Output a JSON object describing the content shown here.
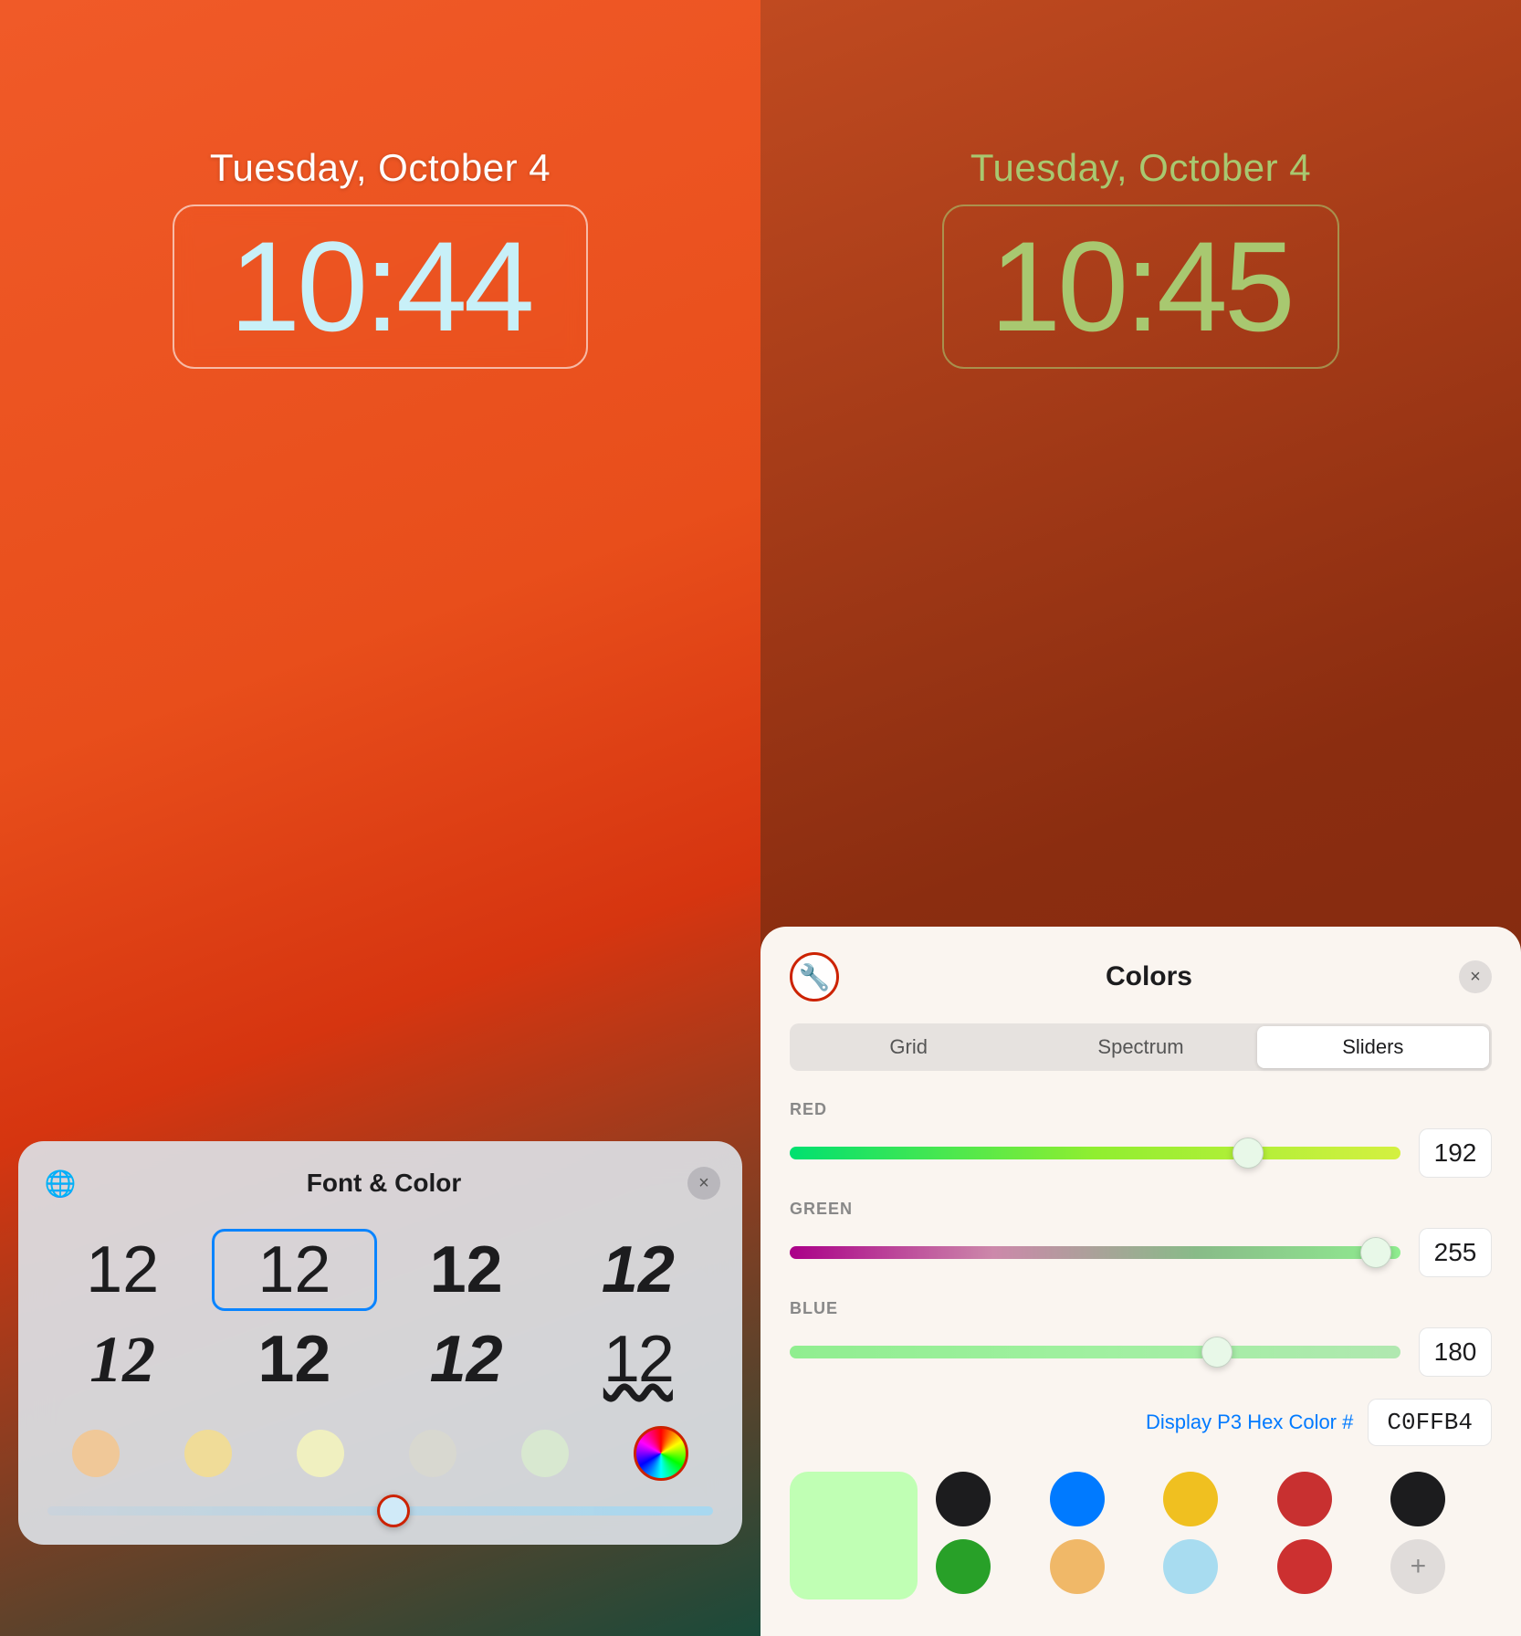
{
  "left": {
    "date": "Tuesday, October 4",
    "time": "10:44",
    "panel_title": "Font & Color",
    "globe_icon": "🌐",
    "close_icon": "×",
    "fonts": [
      {
        "label": "12",
        "style": "light",
        "selected": false
      },
      {
        "label": "12",
        "style": "regular",
        "selected": true
      },
      {
        "label": "12",
        "style": "semibold",
        "selected": false
      },
      {
        "label": "12",
        "style": "bold-italic",
        "selected": false
      },
      {
        "label": "12",
        "style": "serif-bold-italic",
        "selected": false
      },
      {
        "label": "12",
        "style": "black",
        "selected": false
      },
      {
        "label": "12",
        "style": "medium-italic",
        "selected": false
      },
      {
        "label": "12",
        "style": "small-caps",
        "selected": false
      }
    ],
    "color_dots": [
      {
        "color": "#f0c898"
      },
      {
        "color": "#f0dc98"
      },
      {
        "color": "#f0f0c0"
      },
      {
        "color": "#d8d8d0"
      },
      {
        "color": "#d8e8d0"
      }
    ],
    "spectrum_dot": true
  },
  "right": {
    "date": "Tuesday, October 4",
    "time": "10:45",
    "panel_title": "Colors",
    "eyedropper_icon": "🔧",
    "close_icon": "×",
    "tabs": [
      "Grid",
      "Spectrum",
      "Sliders"
    ],
    "active_tab": "Sliders",
    "sliders": [
      {
        "label": "RED",
        "value": 192,
        "thumb_pct": 75
      },
      {
        "label": "GREEN",
        "value": 255,
        "thumb_pct": 96
      },
      {
        "label": "BLUE",
        "value": 180,
        "thumb_pct": 70
      }
    ],
    "hex_label": "Display P3 Hex Color #",
    "hex_value": "C0FFB4",
    "selected_swatch_color": "#c0ffb4",
    "palette": [
      {
        "color": "#1c1c1e",
        "row": 0
      },
      {
        "color": "#007aff",
        "row": 0
      },
      {
        "color": "#f0c020",
        "row": 0
      },
      {
        "color": "#c83030",
        "row": 0
      },
      {
        "color": "#1c1c1e",
        "row": 0
      },
      {
        "color": "#28a028",
        "row": 1
      },
      {
        "color": "#f0b868",
        "row": 1
      },
      {
        "color": "#a8dcf0",
        "row": 1
      },
      {
        "color": "#cc3030",
        "row": 1
      },
      {
        "color": "add",
        "row": 1
      }
    ]
  }
}
